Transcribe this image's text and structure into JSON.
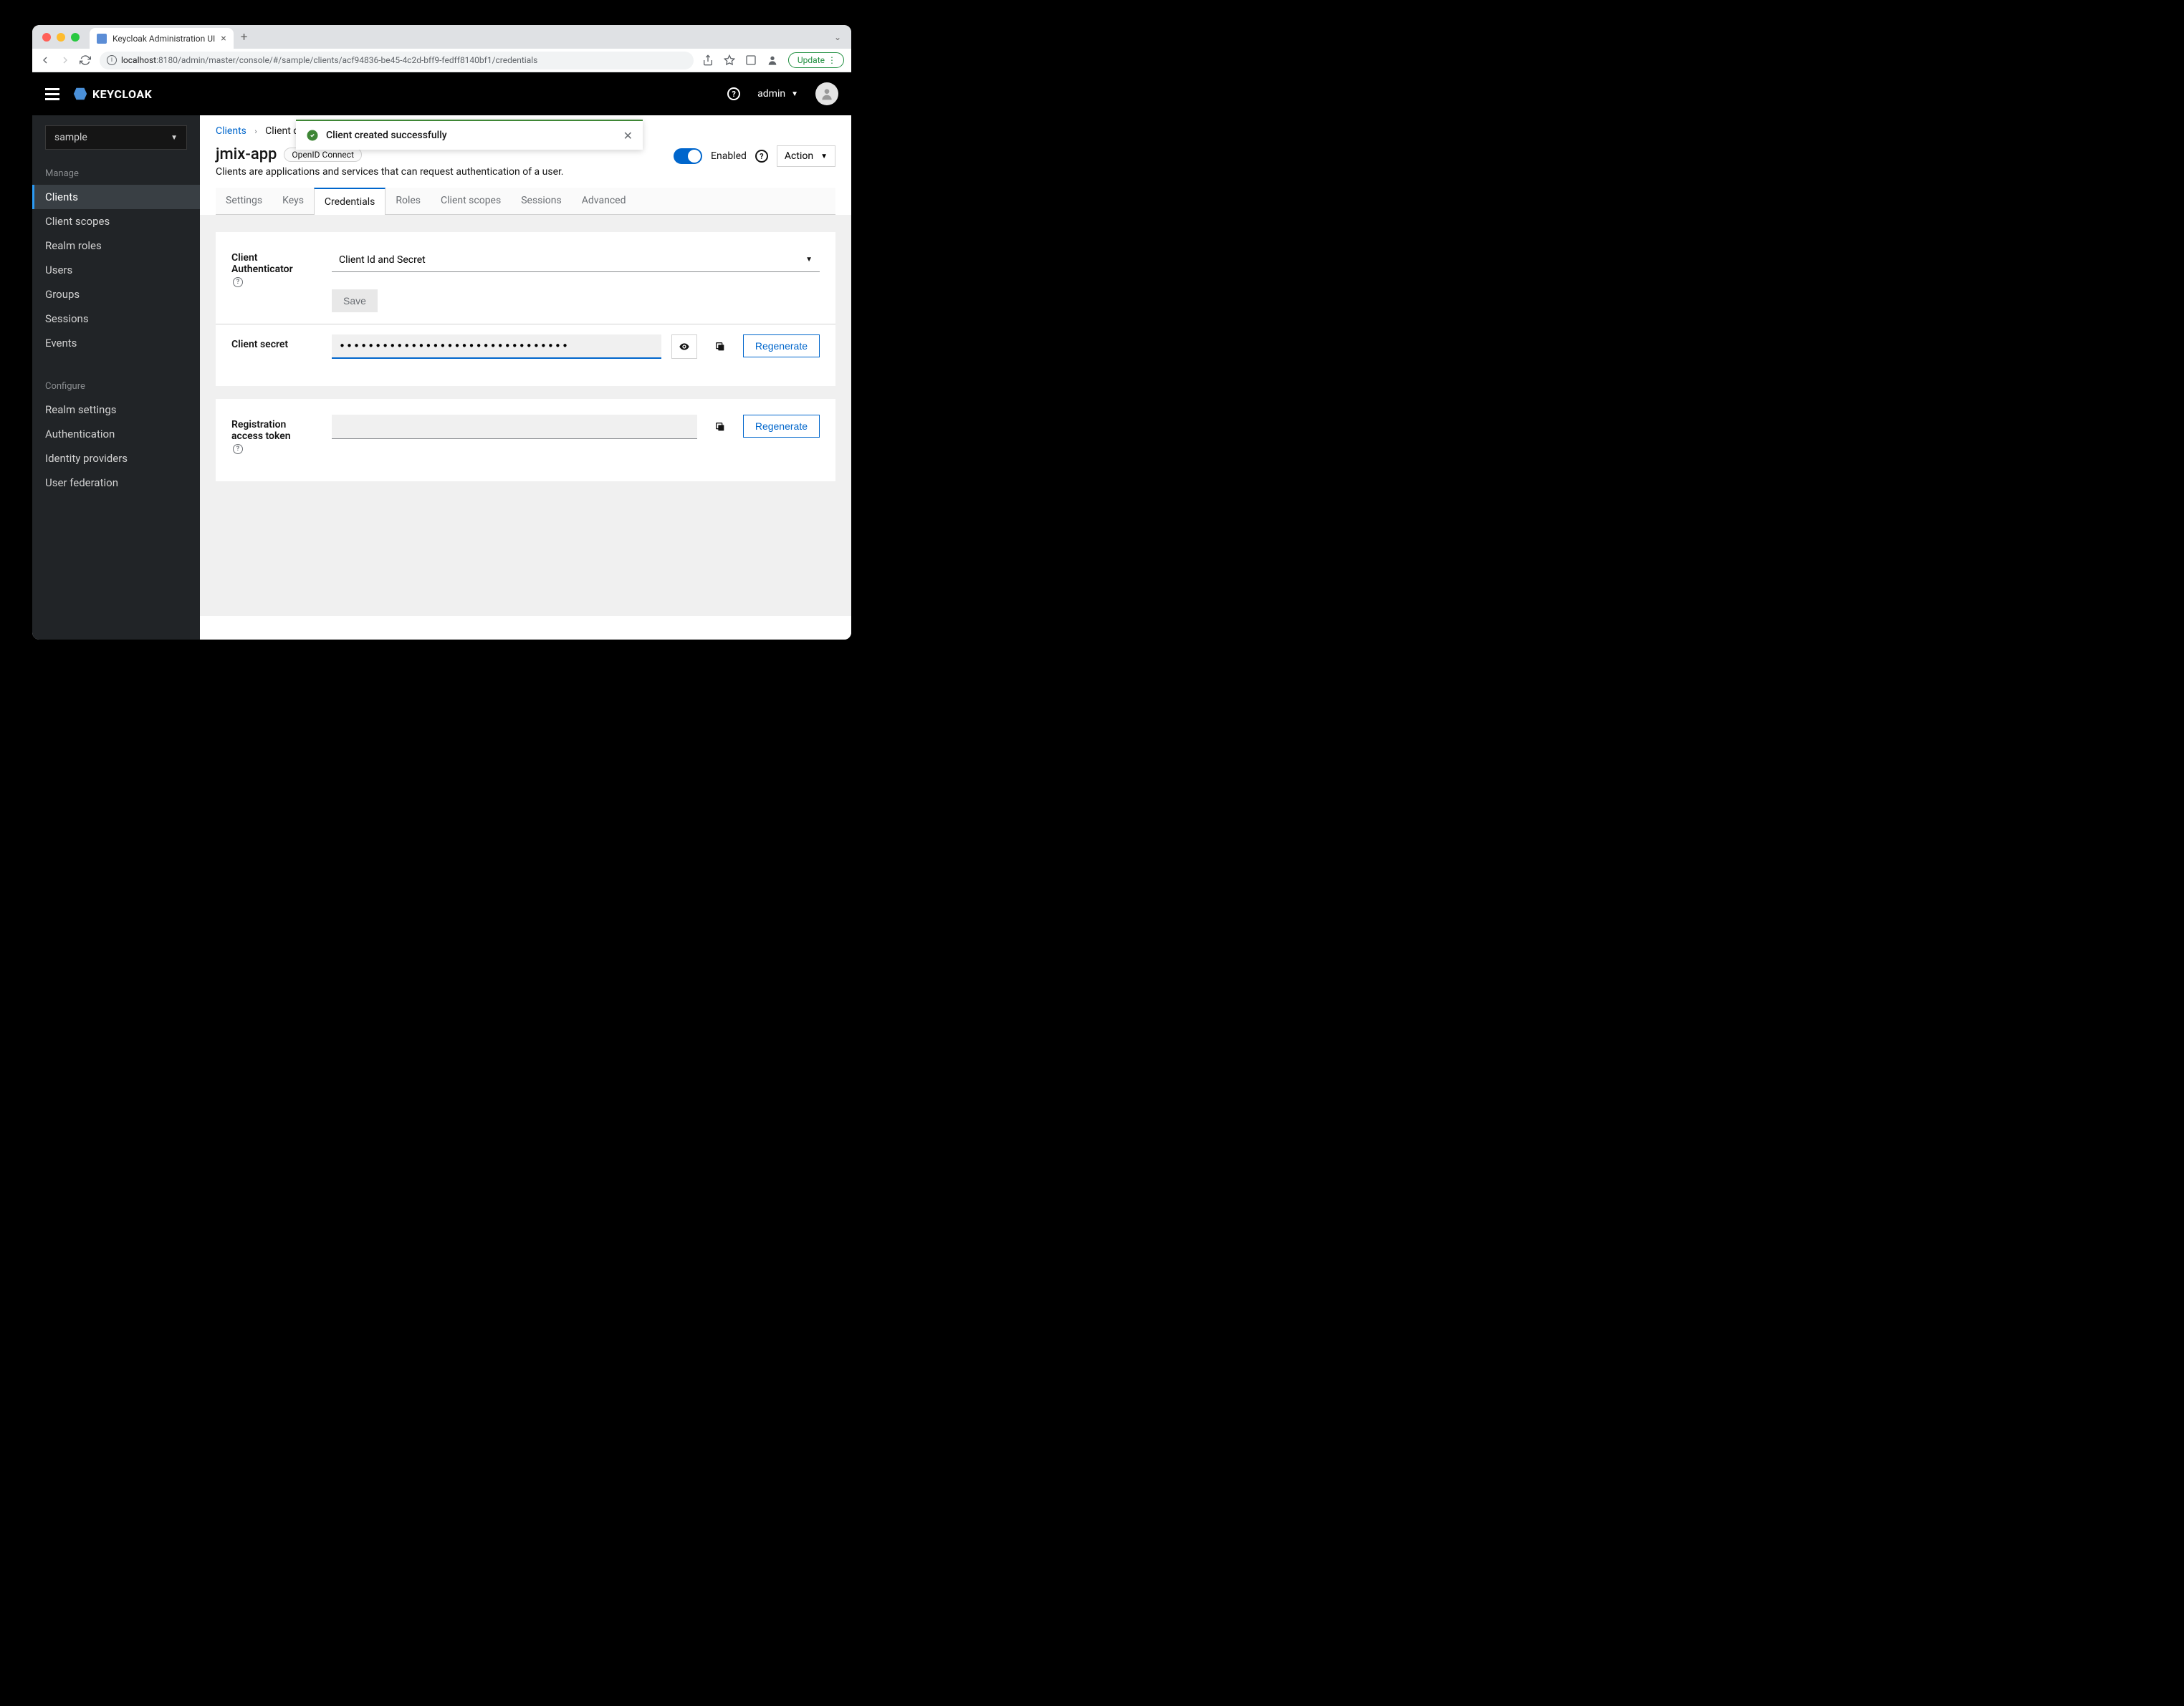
{
  "browser": {
    "tab_title": "Keycloak Administration UI",
    "url_host": "localhost",
    "url_path": ":8180/admin/master/console/#/sample/clients/acf94836-be45-4c2d-bff9-fedff8140bf1/credentials",
    "update_label": "Update"
  },
  "header": {
    "logo_text": "KEYCLOAK",
    "user_label": "admin"
  },
  "toast": {
    "text": "Client created successfully"
  },
  "sidebar": {
    "realm": "sample",
    "section_manage": "Manage",
    "section_configure": "Configure",
    "manage_items": [
      "Clients",
      "Client scopes",
      "Realm roles",
      "Users",
      "Groups",
      "Sessions",
      "Events"
    ],
    "configure_items": [
      "Realm settings",
      "Authentication",
      "Identity providers",
      "User federation"
    ],
    "active_item": "Clients"
  },
  "breadcrumb": {
    "root": "Clients",
    "current": "Client details"
  },
  "page": {
    "title": "jmix-app",
    "protocol": "OpenID Connect",
    "description": "Clients are applications and services that can request authentication of a user.",
    "enabled_label": "Enabled",
    "action_label": "Action"
  },
  "tabs": [
    "Settings",
    "Keys",
    "Credentials",
    "Roles",
    "Client scopes",
    "Sessions",
    "Advanced"
  ],
  "active_tab": "Credentials",
  "credentials": {
    "authenticator_label": "Client Authenticator",
    "authenticator_value": "Client Id and Secret",
    "save_label": "Save",
    "secret_label": "Client secret",
    "secret_masked": "••••••••••••••••••••••••••••••••",
    "regenerate_label": "Regenerate",
    "reg_token_label": "Registration access token"
  }
}
